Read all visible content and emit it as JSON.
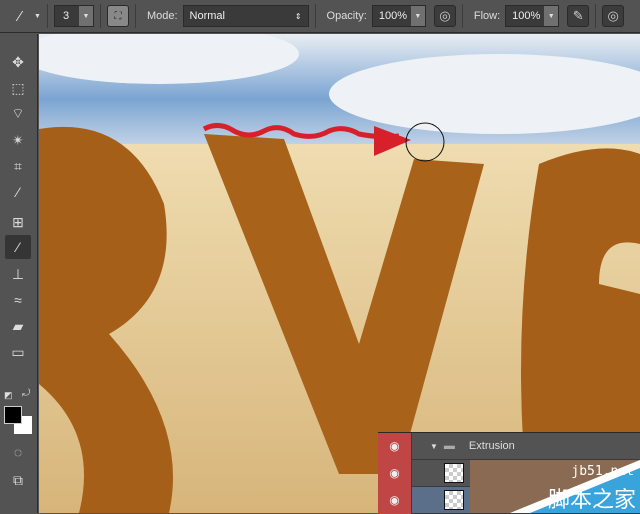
{
  "options_bar": {
    "brush_size": "3",
    "mode_label": "Mode:",
    "mode_value": "Normal",
    "opacity_label": "Opacity:",
    "opacity_value": "100%",
    "flow_label": "Flow:",
    "flow_value": "100%"
  },
  "toolbox": {
    "tools": [
      "move",
      "rectangular-marquee",
      "polygonal-lasso",
      "magic-wand",
      "crop",
      "eyedropper",
      "spot-healing",
      "brush",
      "clone-stamp",
      "history-brush",
      "eraser",
      "gradient"
    ],
    "active": "brush",
    "foreground_color": "#000000",
    "background_color": "#ffffff"
  },
  "layers": {
    "group_name": "Extrusion"
  },
  "watermark": {
    "site": "jb51.net",
    "name": "脚本之家"
  },
  "colors": {
    "arrow": "#d8202a",
    "sky": "#6a9bd0",
    "hay": "#e8d2a4",
    "letters": "#a55f18"
  }
}
